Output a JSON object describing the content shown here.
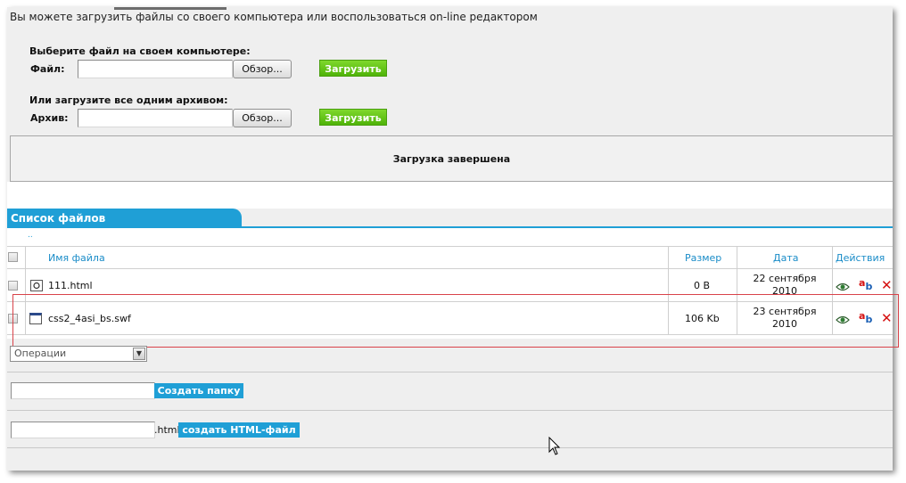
{
  "intro_text": "Вы можете загрузить файлы со своего компьютера или воспользоваться on-line редактором",
  "upload_single": {
    "heading": "Выберите файл на своем компьютере:",
    "label": "Файл:",
    "browse_label": "Обзор...",
    "submit_label": "Загрузить"
  },
  "upload_archive": {
    "heading": "Или загрузите все одним архивом:",
    "label": "Архив:",
    "browse_label": "Обзор...",
    "submit_label": "Загрузить"
  },
  "status_message": "Загрузка завершена",
  "file_list": {
    "tab_title": "Список файлов",
    "up_link": "..",
    "columns": {
      "name": "Имя файла",
      "size": "Размер",
      "date": "Дата",
      "actions": "Действия"
    },
    "rows": [
      {
        "name": "111.html",
        "size": "0 B",
        "date_line1": "22 сентября",
        "date_line2": "2010",
        "rename_icon_text": "ab"
      },
      {
        "name": "css2_4asi_bs.swf",
        "size": "106 Kb",
        "date_line1": "23 сентября",
        "date_line2": "2010",
        "rename_icon_text": "ab"
      }
    ]
  },
  "operations": {
    "selected": "Операции",
    "arrow": "▼"
  },
  "create_folder": {
    "value": "",
    "button_label": "Создать папку"
  },
  "create_html": {
    "value": "",
    "suffix": ".html",
    "button_label": "создать HTML-файл"
  },
  "colors": {
    "accent_blue": "#1f9fd6",
    "green_button": "#5cbf12",
    "delete_red": "#d51010",
    "highlight_frame": "#d9434a"
  },
  "icons": {
    "view": "eye-icon",
    "rename": "rename-icon",
    "delete": "delete-icon",
    "html_file": "html-file-icon",
    "swf_file": "swf-file-icon"
  }
}
